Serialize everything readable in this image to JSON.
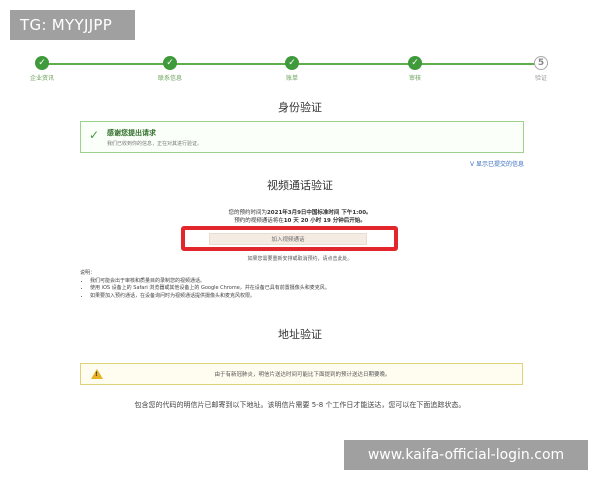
{
  "tag": "TG: MYYJJPP",
  "watermark": "www.kaifa-official-login.com",
  "steps": [
    {
      "label": "企业资讯",
      "icon": "check"
    },
    {
      "label": "联系信息",
      "icon": "check"
    },
    {
      "label": "账单",
      "icon": "check"
    },
    {
      "label": "审核",
      "icon": "check"
    },
    {
      "label": "验证",
      "icon": "5"
    }
  ],
  "identity": {
    "title": "身份验证",
    "confirm_title": "感谢您提出请求",
    "confirm_sub": "我们已收到你的信息，正在对其进行验证。",
    "show_info": "V 显示已提交的信息"
  },
  "video": {
    "title": "视频通话验证",
    "line1_prefix": "您的预约时间为",
    "line1_value": "2021年3月9日中国标准时间 下午1:00。",
    "line2_prefix": "预约的视频通话将在",
    "line2_value": "10 天 20 小时 19 分钟后开始。",
    "join_button": "加入视频通话",
    "reschedule": "如果您需要重新安排或取消预约，请点击此处。"
  },
  "notes": {
    "heading": "说明：",
    "items": [
      "我们可能会出于审核和质量目的录制您的视频通话。",
      "使用 iOS 设备上的 Safari 浏览器或其他设备上的 Google Chrome，并在设备已具有前置摄像头和麦克风。",
      "如果要加入预约通话，在设备询问时为视频通话提供摄像头和麦克风权限。"
    ]
  },
  "address": {
    "title": "地址验证",
    "warning": "由于有新冠肺炎，明信片送达时间可能比下面提到的预计送达日期要晚。",
    "bottom": "包含您的代码的明信片已邮寄到以下地址。该明信片需要 5-8 个工作日才能送达，您可以在下面追踪状态。"
  },
  "colors": {
    "success": "#3f9a3c",
    "highlight": "#e2262b",
    "warning": "#e7b324",
    "link": "#3a6fbf"
  }
}
